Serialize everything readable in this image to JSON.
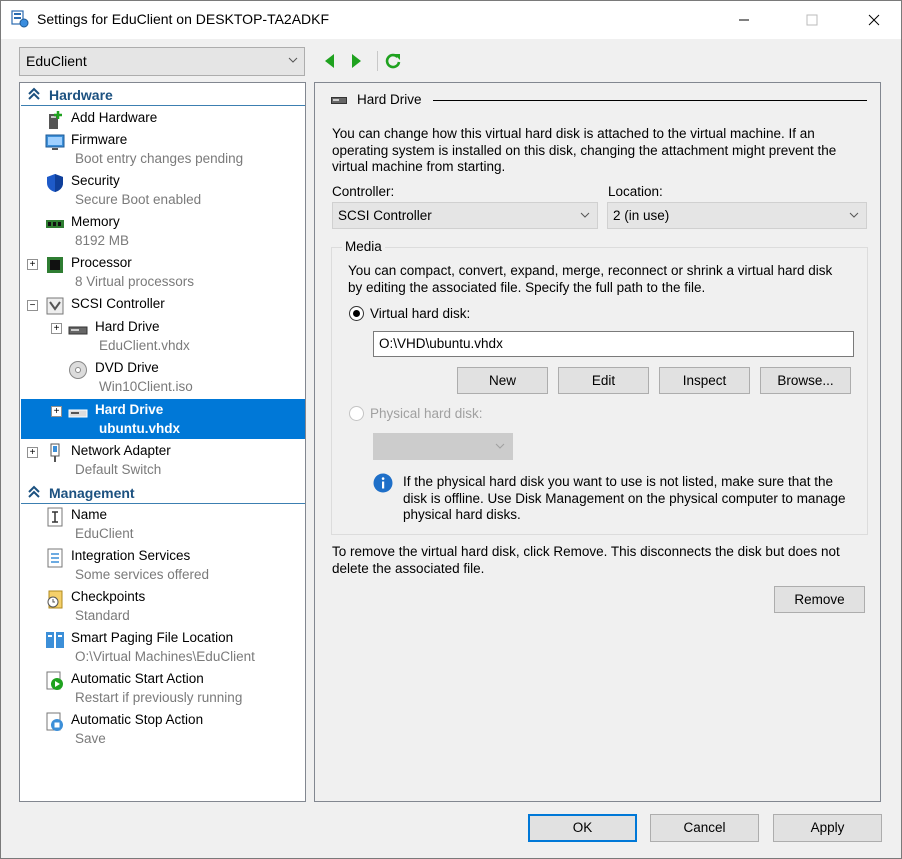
{
  "window": {
    "title": "Settings for EduClient on DESKTOP-TA2ADKF"
  },
  "vm_selector": {
    "value": "EduClient"
  },
  "tree": {
    "hardware_header": "Hardware",
    "management_header": "Management",
    "items": [
      {
        "label": "Add Hardware",
        "sub": ""
      },
      {
        "label": "Firmware",
        "sub": "Boot entry changes pending"
      },
      {
        "label": "Security",
        "sub": "Secure Boot enabled"
      },
      {
        "label": "Memory",
        "sub": "8192 MB"
      },
      {
        "label": "Processor",
        "sub": "8 Virtual processors"
      },
      {
        "label": "SCSI Controller",
        "sub": ""
      },
      {
        "label": "Hard Drive",
        "sub": "EduClient.vhdx"
      },
      {
        "label": "DVD Drive",
        "sub": "Win10Client.iso"
      },
      {
        "label": "Hard Drive",
        "sub": "ubuntu.vhdx"
      },
      {
        "label": "Network Adapter",
        "sub": "Default Switch"
      },
      {
        "label": "Name",
        "sub": "EduClient"
      },
      {
        "label": "Integration Services",
        "sub": "Some services offered"
      },
      {
        "label": "Checkpoints",
        "sub": "Standard"
      },
      {
        "label": "Smart Paging File Location",
        "sub": "O:\\Virtual Machines\\EduClient"
      },
      {
        "label": "Automatic Start Action",
        "sub": "Restart if previously running"
      },
      {
        "label": "Automatic Stop Action",
        "sub": "Save"
      }
    ]
  },
  "detail": {
    "group_title": "Hard Drive",
    "intro_lines": [
      "You can change how this virtual hard disk is attached to the virtual machine. If an",
      "operating system is installed on this disk, changing the attachment might prevent the",
      "virtual machine from starting."
    ],
    "controller_label": "Controller:",
    "controller_value": "SCSI Controller",
    "location_label": "Location:",
    "location_value": "2 (in use)",
    "media_title": "Media",
    "media_lines": [
      "You can compact, convert, expand, merge, reconnect or shrink a virtual hard disk",
      "by editing the associated file. Specify the full path to the file."
    ],
    "vhd_radio_label": "Virtual hard disk:",
    "vhd_path": "O:\\VHD\\ubuntu.vhdx",
    "buttons": {
      "new": "New",
      "edit": "Edit",
      "inspect": "Inspect",
      "browse": "Browse..."
    },
    "physical_radio_label": "Physical hard disk:",
    "info_lines": [
      "If the physical hard disk you want to use is not listed, make sure that the",
      "disk is offline. Use Disk Management on the physical computer to manage",
      "physical hard disks."
    ],
    "remove_lines": [
      "To remove the virtual hard disk, click Remove. This disconnects the disk but does not",
      "delete the associated file."
    ],
    "remove_button": "Remove"
  },
  "footer": {
    "ok": "OK",
    "cancel": "Cancel",
    "apply": "Apply"
  },
  "colors": {
    "selection": "#0078d7",
    "section_header": "#1c5180",
    "nav_arrow": "#1fa21f"
  }
}
